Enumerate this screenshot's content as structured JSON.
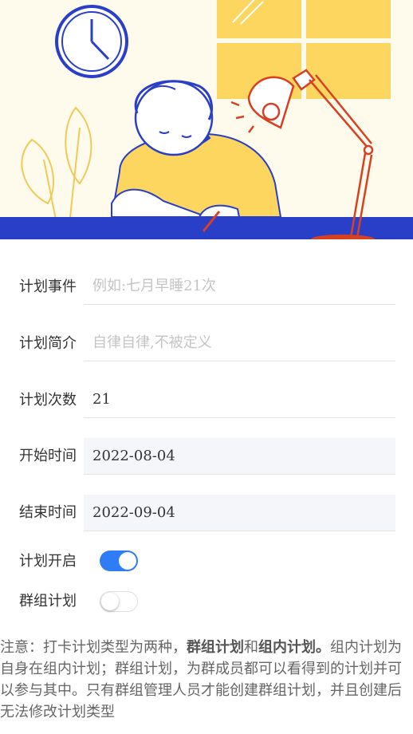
{
  "form": {
    "event_label": "计划事件",
    "event_placeholder": "例如:七月早睡21次",
    "event_value": "",
    "intro_label": "计划简介",
    "intro_placeholder": "自律自律,不被定义",
    "intro_value": "",
    "count_label": "计划次数",
    "count_value": "21",
    "start_label": "开始时间",
    "start_value": "2022-08-04",
    "end_label": "结束时间",
    "end_value": "2022-09-04",
    "enable_label": "计划开启",
    "enable_on": true,
    "group_label": "群组计划",
    "group_on": false
  },
  "note": {
    "prefix": "注意：打卡计划类型为两种，",
    "type1": "群组计划",
    "and": "和",
    "type2": "组内计划。",
    "rest": "组内计划为自身在组内计划；群组计划，为群成员都可以看得到的计划并可以参与其中。只有群组管理人员才能创建群组计划，并且创建后无法修改计划类型"
  },
  "colors": {
    "accent": "#2e7cf6",
    "illustration_blue": "#2a3fc7",
    "illustration_yellow": "#fcd65f"
  }
}
